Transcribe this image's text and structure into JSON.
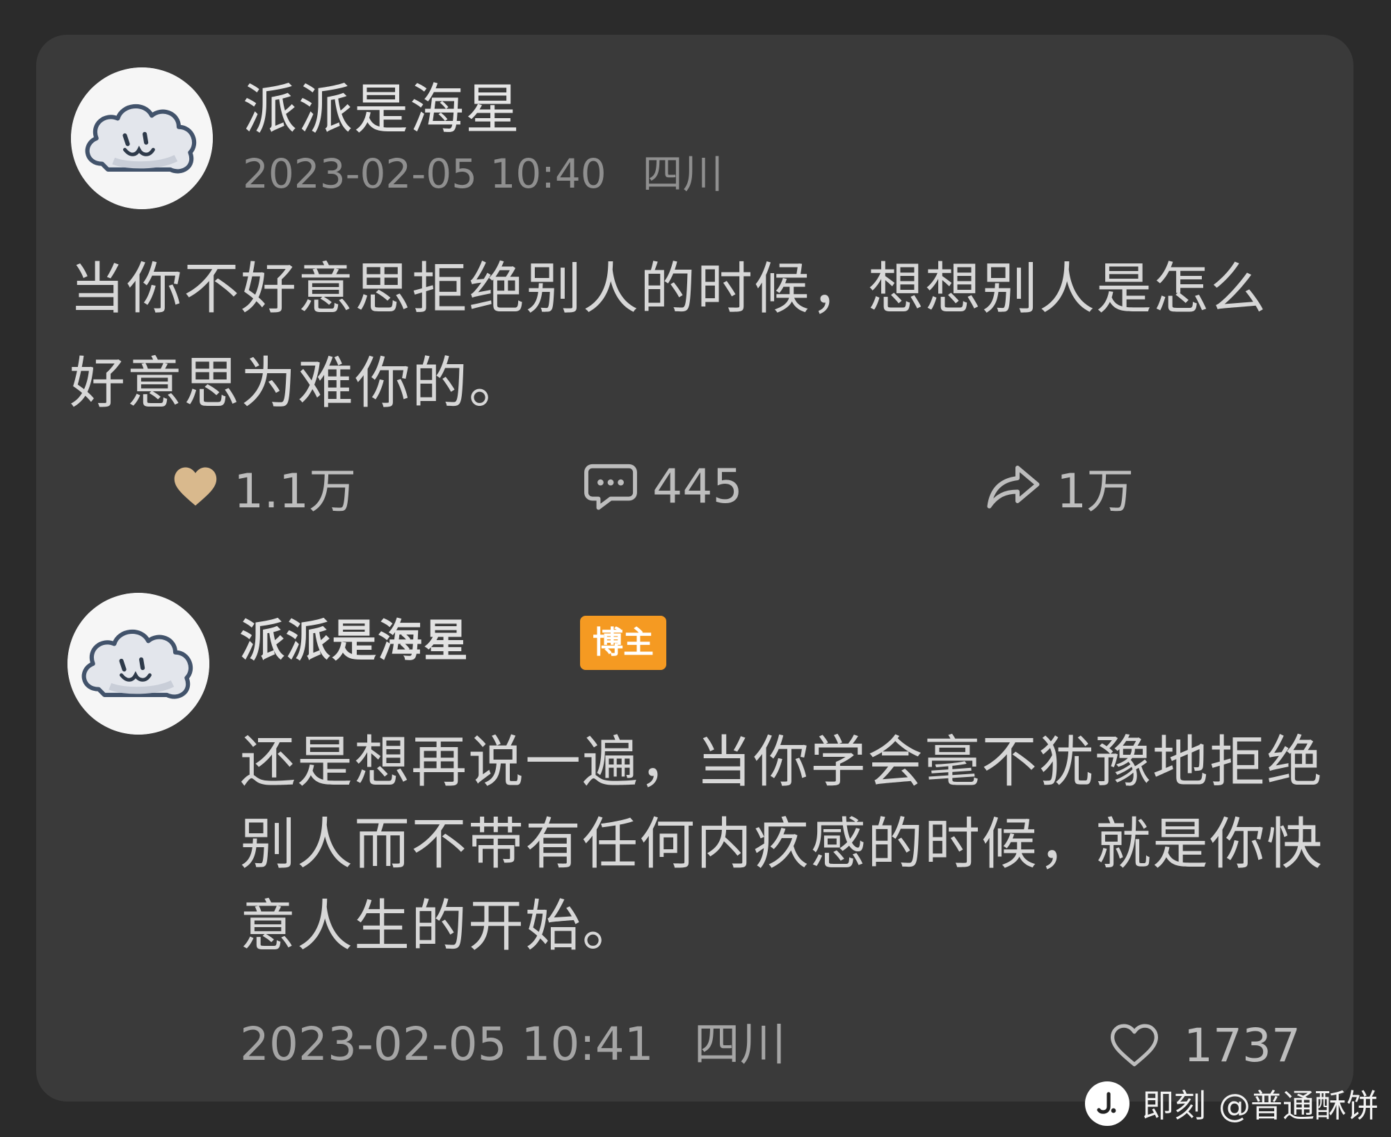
{
  "post": {
    "author": "派派是海星",
    "timestamp": "2023-02-05 10:40",
    "location": "四川",
    "text": "当你不好意思拒绝别人的时候，想想别人是怎么好意思为难你的。",
    "likes": "1.1万",
    "comments": "445",
    "shares": "1万"
  },
  "reply": {
    "author": "派派是海星",
    "badge": "博主",
    "text": "还是想再说一遍，当你学会毫不犹豫地拒绝别人而不带有任何内疚感的时候，就是你快意人生的开始。",
    "timestamp": "2023-02-05 10:41",
    "location": "四川",
    "likes": "1737"
  },
  "watermark": {
    "app": "即刻",
    "handle": "@普通酥饼"
  },
  "icons": {
    "avatar": "cloud-avatar-icon",
    "like_filled": "heart-filled-icon",
    "comment": "comment-bubble-icon",
    "share": "share-arrow-icon",
    "like_outline": "heart-outline-icon",
    "app_logo": "jike-logo-icon"
  },
  "colors": {
    "background": "#2b2b2b",
    "card": "#3a3a3a",
    "like_active": "#d9b98d",
    "badge": "#f59a22",
    "muted_text": "#8f8f8f"
  }
}
